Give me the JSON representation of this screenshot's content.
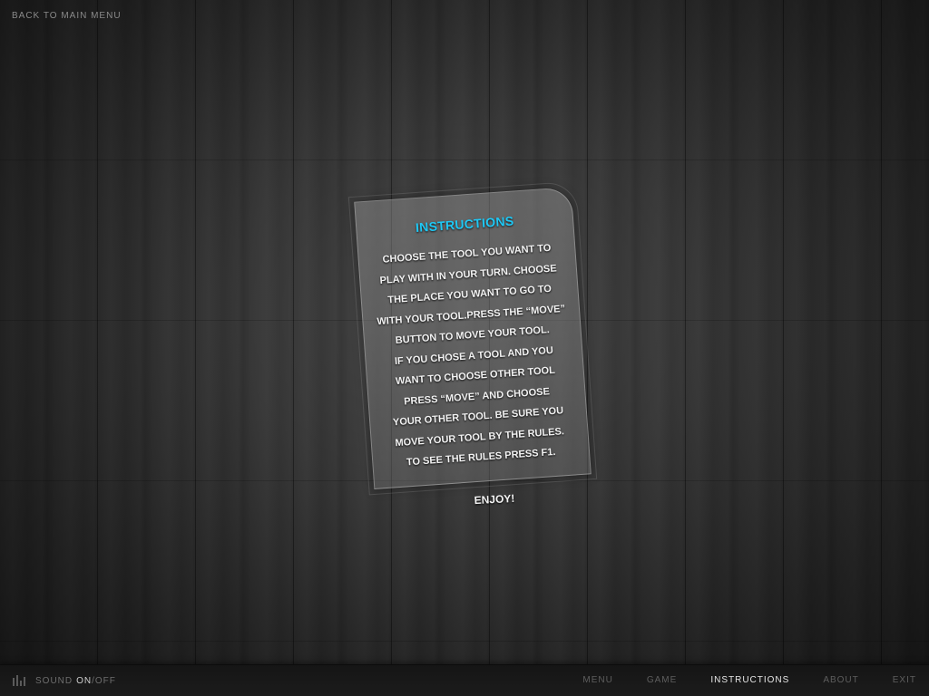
{
  "header": {
    "back_label": "BACK TO MAIN MENU"
  },
  "card": {
    "title": "INSTRUCTIONS",
    "lines": [
      "CHOOSE THE TOOL YOU WANT TO",
      "PLAY WITH IN YOUR TURN. CHOOSE",
      "THE PLACE YOU WANT TO GO TO",
      "WITH YOUR TOOL.PRESS THE “MOVE”",
      "BUTTON TO MOVE YOUR TOOL.",
      "IF YOU CHOSE A TOOL AND YOU",
      "WANT TO CHOOSE OTHER TOOL",
      "PRESS “MOVE” AND CHOOSE",
      "YOUR OTHER TOOL. BE SURE YOU",
      "MOVE YOUR TOOL BY THE RULES.",
      "TO SEE THE RULES PRESS F1."
    ],
    "footer": "ENJOY!"
  },
  "footer_bar": {
    "sound": {
      "label": "SOUND",
      "on": "ON",
      "separator": "/",
      "off": "OFF",
      "icon": "sound-bars-icon"
    },
    "nav": {
      "menu": "MENU",
      "game": "GAME",
      "instructions": "INSTRUCTIONS",
      "about": "ABOUT",
      "exit": "EXIT",
      "active": "instructions"
    }
  },
  "colors": {
    "title_accent": "#1ec8f5",
    "active_nav": "#e6e6e6",
    "inactive_nav": "#5e5e5e"
  }
}
